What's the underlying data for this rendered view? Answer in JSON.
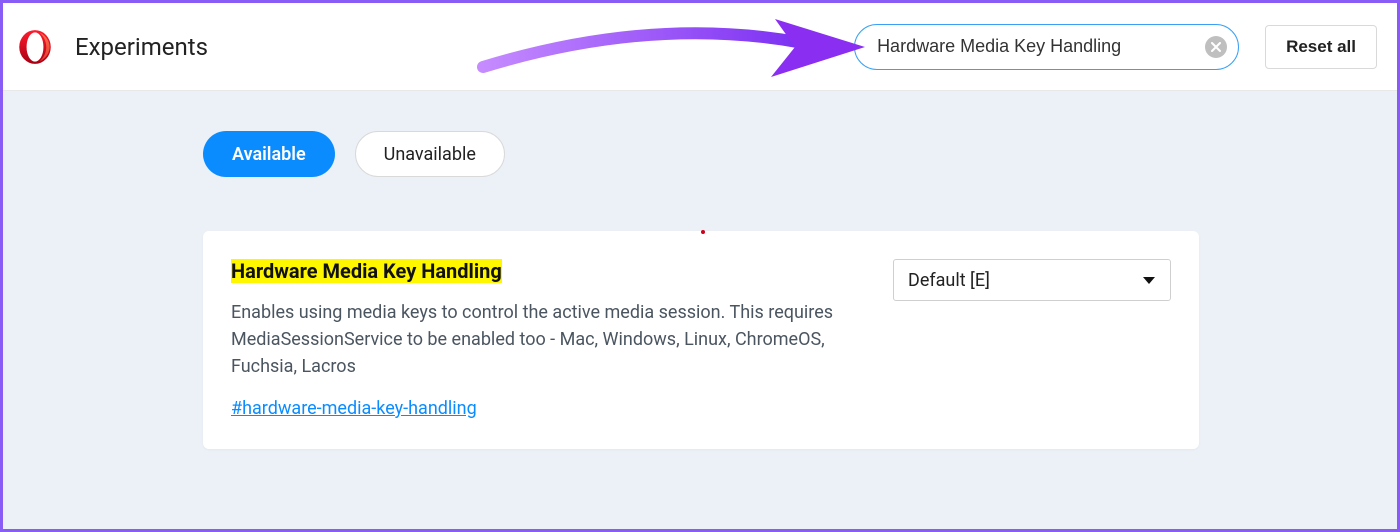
{
  "header": {
    "page_title": "Experiments",
    "search_value": "Hardware Media Key Handling",
    "reset_label": "Reset all"
  },
  "tabs": {
    "available": "Available",
    "unavailable": "Unavailable"
  },
  "flag": {
    "title": "Hardware Media Key Handling",
    "description": "Enables using media keys to control the active media session. This requires MediaSessionService to be enabled too - Mac, Windows, Linux, ChromeOS, Fuchsia, Lacros",
    "link": "#hardware-media-key-handling",
    "select_value": "Default [E]"
  }
}
